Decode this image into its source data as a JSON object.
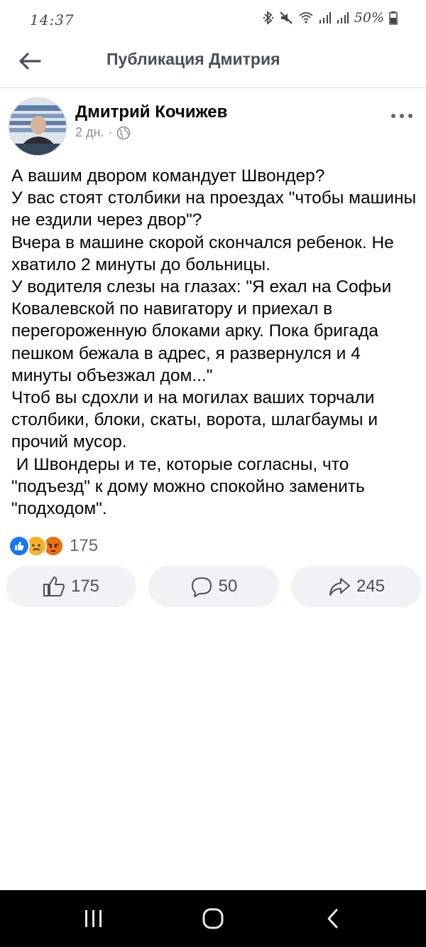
{
  "status_bar": {
    "time": "14:37",
    "battery": "50%",
    "icons": [
      "bluetooth-icon",
      "mute-icon",
      "wifi-icon",
      "signal-icon",
      "signal-icon",
      "battery-icon"
    ]
  },
  "header": {
    "title": "Публикация Дмитрия",
    "back_icon": "arrow-left-icon"
  },
  "post": {
    "author": "Дмитрий Кочижев",
    "time": "2 дн.",
    "separator": "·",
    "privacy_icon": "globe-icon",
    "more_icon": "more-dots-icon",
    "text": "А вашим двором командует Швондер?\nУ вас стоят столбики на проездах \"чтобы машины не ездили через двор\"?\nВчера в машине скорой скончался ребенок. Не хватило 2 минуты до больницы.\nУ водителя слезы на глазах: \"Я ехал на Софьи Ковалевской по навигатору и приехал в перегороженную блоками арку. Пока бригада пешком бежала в адрес, я развернулся и 4 минуты объезжал дом...\"\nЧтоб вы сдохли и на могилах ваших торчали столбики, блоки, скаты, ворота, шлагбаумы и прочий мусор.\n И Швондеры и те, которые согласны, что \"подъезд\" к дому можно спокойно заменить \"подходом\".",
    "reactions": {
      "icons": [
        "like-icon",
        "sad-icon",
        "angry-icon"
      ],
      "count": "175"
    },
    "actions": {
      "like_count": "175",
      "comment_count": "50",
      "share_count": "245"
    }
  },
  "nav_bar": {
    "items": [
      "recent-apps-icon",
      "home-icon",
      "back-icon"
    ]
  },
  "colors": {
    "like_blue": "#1877f2",
    "sad_yellow": "#f7b125",
    "angry_orange": "#e9710f",
    "button_bg": "#f0f2f5"
  }
}
